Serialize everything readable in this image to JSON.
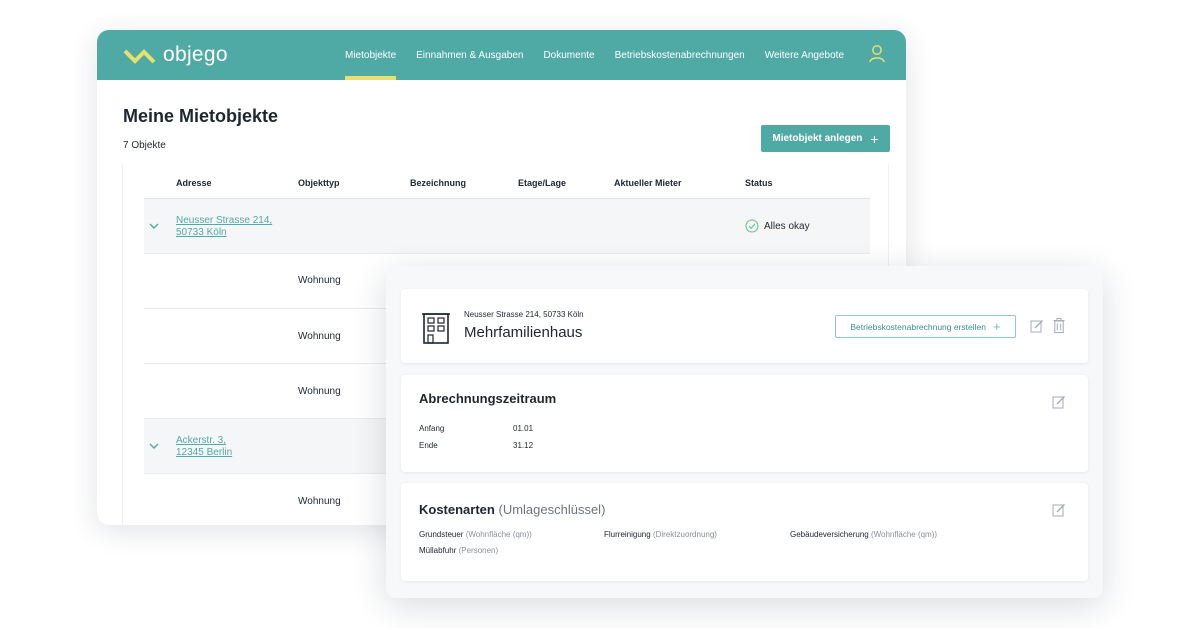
{
  "app": {
    "logo_text": "objego",
    "nav": [
      "Mietobjekte",
      "Einnahmen & Ausgaben",
      "Dokumente",
      "Betriebskostenabrechnungen",
      "Weitere Angebote"
    ],
    "active_nav": "Mietobjekte",
    "user_icon": "user-icon"
  },
  "page": {
    "title": "Meine Mietobjekte",
    "count": "7 Objekte",
    "add_button": "Mietobjekt anlegen",
    "add_button_icon": "+"
  },
  "table": {
    "columns": [
      "Adresse",
      "Objekttyp",
      "Bezeichnung",
      "Etage/Lage",
      "Aktueller Mieter",
      "Status"
    ],
    "rows": [
      {
        "kind": "group",
        "address_line1": "Neusser Strasse 214,",
        "address_line2": "50733 Köln",
        "status": "Alles okay"
      },
      {
        "kind": "unit",
        "type": "Wohnung"
      },
      {
        "kind": "unit",
        "type": "Wohnung"
      },
      {
        "kind": "unit",
        "type": "Wohnung"
      },
      {
        "kind": "group",
        "address_line1": "Ackerstr. 3,",
        "address_line2": "12345 Berlin"
      },
      {
        "kind": "unit",
        "type": "Wohnung"
      }
    ]
  },
  "detail": {
    "address": "Neusser Strasse 214, 50733 Köln",
    "property_type": "Mehrfamilienhaus",
    "bk_button": "Betriebskostenabrechnung erstellen",
    "bk_button_icon": "+",
    "period": {
      "title": "Abrechnungszeitraum",
      "start_label": "Anfang",
      "start_value": "01.01",
      "end_label": "Ende",
      "end_value": "31.12"
    },
    "costs": {
      "title": "Kostenarten",
      "title_suffix": "(Umlageschlüssel)",
      "items": [
        {
          "name": "Grundsteuer",
          "key": "(Wohnfläche (qm))"
        },
        {
          "name": "Flurreinigung",
          "key": "(Direktzuordnung)"
        },
        {
          "name": "Gebäudeversicherung",
          "key": "(Wohnfläche (qm))"
        },
        {
          "name": "Müllabfuhr",
          "key": "(Personen)"
        }
      ]
    }
  },
  "colors": {
    "brand": "#4fa9a4",
    "accent": "#e8e06c",
    "status_ok": "#6cc28a",
    "text": "#1e2630"
  }
}
